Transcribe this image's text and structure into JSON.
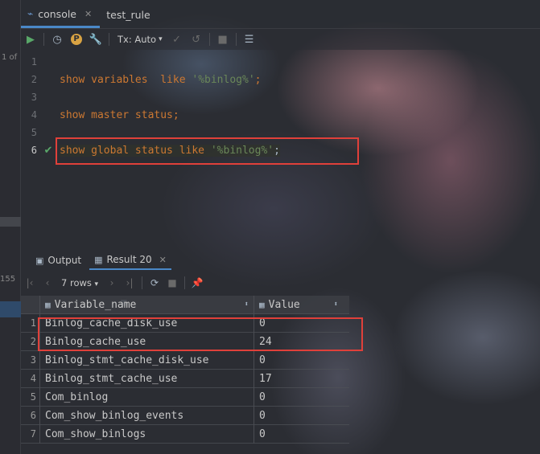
{
  "left_strip": {
    "pager": "1 of",
    "count": "155"
  },
  "tabs": [
    {
      "label": "console",
      "icon": "console-icon",
      "active": true
    },
    {
      "label": "test_rule",
      "icon": "table-icon",
      "active": false
    }
  ],
  "toolbar": {
    "tx_label": "Tx: Auto",
    "p_badge": "P"
  },
  "editor": {
    "lines": [
      {
        "num": "1",
        "tokens": []
      },
      {
        "num": "2",
        "tokens": [
          {
            "t": "kw",
            "v": "show variables  like "
          },
          {
            "t": "str",
            "v": "'%binlog%'"
          },
          {
            "t": "kw",
            "v": ";"
          }
        ]
      },
      {
        "num": "3",
        "tokens": []
      },
      {
        "num": "4",
        "tokens": [
          {
            "t": "kw",
            "v": "show master status;"
          }
        ]
      },
      {
        "num": "5",
        "tokens": []
      },
      {
        "num": "6",
        "tokens": [
          {
            "t": "kw",
            "v": "show global status like "
          },
          {
            "t": "str",
            "v": "'%binlog%'"
          },
          {
            "t": "plain",
            "v": ";"
          }
        ]
      }
    ]
  },
  "panel": {
    "output_label": "Output",
    "result_label": "Result 20"
  },
  "results_toolbar": {
    "rows_label": "7 rows"
  },
  "grid": {
    "columns": [
      "Variable_name",
      "Value"
    ],
    "rows": [
      {
        "n": "1",
        "name": "Binlog_cache_disk_use",
        "value": "0"
      },
      {
        "n": "2",
        "name": "Binlog_cache_use",
        "value": "24"
      },
      {
        "n": "3",
        "name": "Binlog_stmt_cache_disk_use",
        "value": "0"
      },
      {
        "n": "4",
        "name": "Binlog_stmt_cache_use",
        "value": "17"
      },
      {
        "n": "5",
        "name": "Com_binlog",
        "value": "0"
      },
      {
        "n": "6",
        "name": "Com_show_binlog_events",
        "value": "0"
      },
      {
        "n": "7",
        "name": "Com_show_binlogs",
        "value": "0"
      }
    ]
  },
  "colors": {
    "highlight_box": "#e0403a",
    "keyword": "#cc7832",
    "string": "#6a8759",
    "accent": "#4a88c7"
  }
}
